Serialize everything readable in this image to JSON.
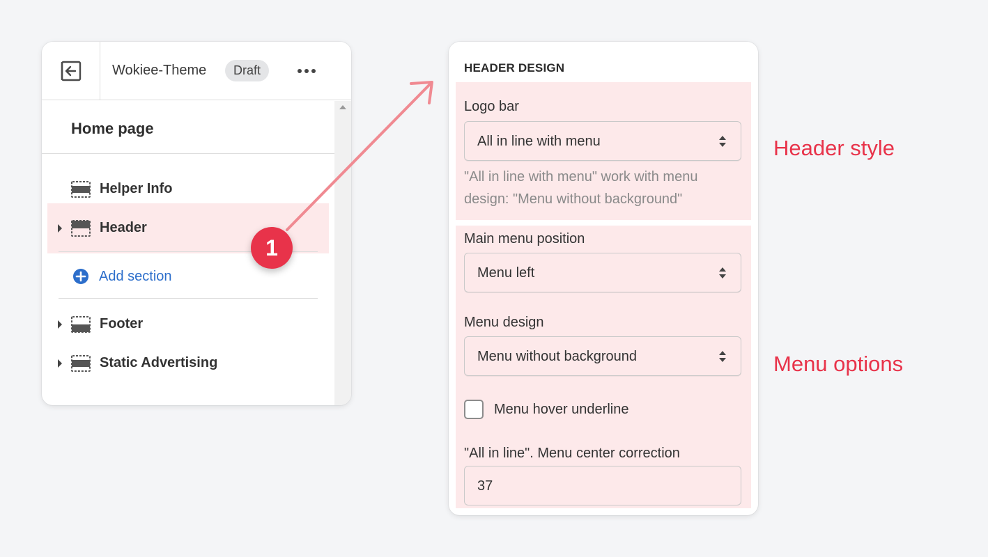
{
  "left_panel": {
    "theme_name": "Wokiee-Theme",
    "status_badge": "Draft",
    "page_title": "Home page",
    "sections": [
      {
        "label": "Helper Info",
        "icon": "section-icon",
        "expandable": false,
        "active": false
      },
      {
        "label": "Header",
        "icon": "header-section-icon",
        "expandable": true,
        "active": true
      },
      {
        "label": "Footer",
        "icon": "footer-section-icon",
        "expandable": true,
        "active": false
      },
      {
        "label": "Static Advertising",
        "icon": "section-icon",
        "expandable": true,
        "active": false
      }
    ],
    "add_section_label": "Add section"
  },
  "right_panel": {
    "heading": "HEADER DESIGN",
    "logo_bar": {
      "label": "Logo bar",
      "value": "All in line with menu",
      "help": "\"All in line with menu\" work with menu design: \"Menu without background\""
    },
    "main_menu_position": {
      "label": "Main menu position",
      "value": "Menu left"
    },
    "menu_design": {
      "label": "Menu design",
      "value": "Menu without background"
    },
    "menu_hover_underline": {
      "label": "Menu hover underline",
      "checked": false
    },
    "menu_center_correction": {
      "label": "\"All in line\". Menu center correction",
      "value": "37"
    }
  },
  "annotations": {
    "step_number": "1",
    "header_style": "Header style",
    "menu_options": "Menu options"
  },
  "colors": {
    "highlight": "#fde9ea",
    "annotation_red": "#e8334a",
    "link_blue": "#2c6ecb",
    "background": "#f4f5f7"
  }
}
